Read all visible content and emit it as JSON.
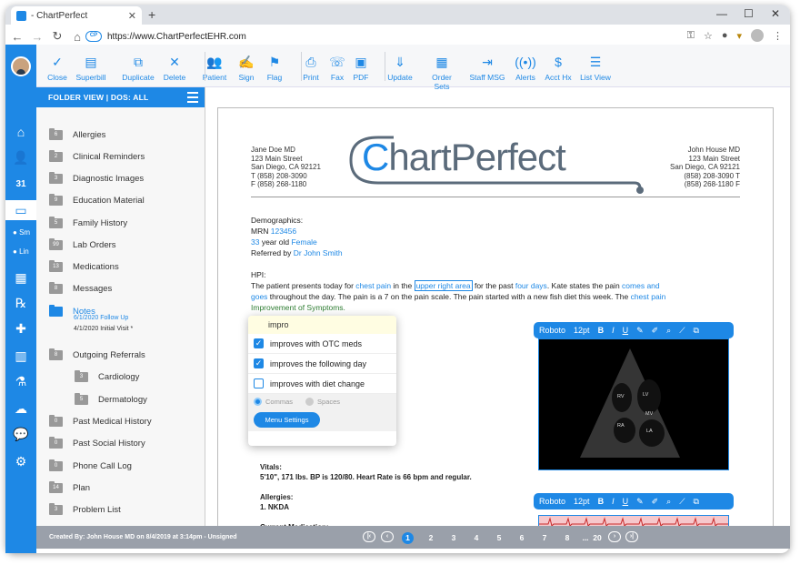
{
  "browser": {
    "tab_title": "- ChartPerfect",
    "url": "https://www.ChartPerfectEHR.com"
  },
  "toolbar": {
    "items": [
      "Close",
      "Superbill",
      "Duplicate",
      "Delete",
      "Patient",
      "Sign",
      "Flag",
      "Print",
      "Fax",
      "PDF",
      "Update",
      "Order Sets",
      "Staff MSG",
      "Alerts",
      "Acct Hx",
      "List View"
    ]
  },
  "leftnav": {
    "sub1": "Sm",
    "sub2": "Lin",
    "calendar_day": "31"
  },
  "folder": {
    "header": "FOLDER VIEW  |  DOS: ALL",
    "items": [
      {
        "count": "6",
        "label": "Allergies"
      },
      {
        "count": "2",
        "label": "Clinical Reminders"
      },
      {
        "count": "3",
        "label": "Diagnostic Images"
      },
      {
        "count": "9",
        "label": "Education Material"
      },
      {
        "count": "5",
        "label": "Family History"
      },
      {
        "count": "99",
        "label": "Lab Orders"
      },
      {
        "count": "13",
        "label": "Medications"
      },
      {
        "count": "8",
        "label": "Messages"
      },
      {
        "count": "9",
        "label": "Notes"
      },
      {
        "count": "8",
        "label": "Outgoing Referrals"
      },
      {
        "count": "3",
        "label": "Cardiology"
      },
      {
        "count": "5",
        "label": "Dermatology"
      },
      {
        "count": "0",
        "label": "Past Medical History"
      },
      {
        "count": "0",
        "label": "Past Social History"
      },
      {
        "count": "0",
        "label": "Phone Call Log"
      },
      {
        "count": "14",
        "label": "Plan"
      },
      {
        "count": "3",
        "label": "Problem List"
      }
    ],
    "notes_sub1": "6/1/2020  Follow Up",
    "notes_sub2": "4/1/2020  Initial Visit *"
  },
  "status": {
    "created_by": "Created By: John House MD on 8/4/2019 at 3:14pm - Unsigned",
    "pages": [
      "1",
      "2",
      "3",
      "4",
      "5",
      "6",
      "7",
      "8",
      "...",
      "20"
    ],
    "current_page": "1"
  },
  "document": {
    "left_address": [
      "Jane Doe MD",
      "123 Main Street",
      "San Diego, CA 92121",
      "T (858) 208-3090",
      "F (858) 268-1180"
    ],
    "right_address": [
      "John House MD",
      "123 Main Street",
      "San Diego, CA 92121",
      "(858) 208-3090 T",
      "(858) 268-1180 F"
    ],
    "logo_c": "C",
    "logo_rest": "hartPerfect",
    "demographics_label": "Demographics:",
    "mrn_label": "MRN ",
    "mrn": "123456",
    "age": "33",
    " age_text": " year old ",
    "sex": "Female",
    "referred_label": "Referred by ",
    "referrer": "Dr John Smith",
    "hpi_label": "HPI:",
    "hpi_1a": "The patient presents today for ",
    "hpi_cp": "chest pain",
    "hpi_1b": " in the ",
    "hpi_area": "upper right area",
    "hpi_1c": " for the past ",
    "hpi_days": "four days",
    ". ": "",
    "hpi_1d": ".  Kate states the pain ",
    "hpi_cg": "comes and",
    "hpi_2a": "goes",
    "hpi_2b": " throughout the day. The pain is a 7 on the pain scale. The pain started with a new fish diet this week. The ",
    "hpi_2c": "chest pain",
    "hpi_3": "Improvement of Symptoms.",
    "vitals_label": "Vitals:",
    "vitals": "5'10\", 171 lbs. BP is 120/80. Heart Rate is 66 bpm and regular.",
    "allergies_label": "Allergies:",
    "allergies": "1. NKDA",
    "medication_label": "Current Medication:"
  },
  "autocomplete": {
    "query": "impro",
    "items": [
      {
        "label": "improves with OTC meds",
        "checked": true
      },
      {
        "label": "improves the following day",
        "checked": true
      },
      {
        "label": "improves with diet change",
        "checked": false
      }
    ],
    "opt1": "Commas",
    "opt2": "Spaces",
    "button": "Menu Settings"
  },
  "editor": {
    "font": "Roboto",
    "size": "12pt",
    "b": "B",
    "i": "I",
    "u": "U"
  },
  "echo_labels": {
    "rv": "RV",
    "lv": "LV",
    "ra": "RA",
    "la": "LA",
    "mv": "MV"
  }
}
